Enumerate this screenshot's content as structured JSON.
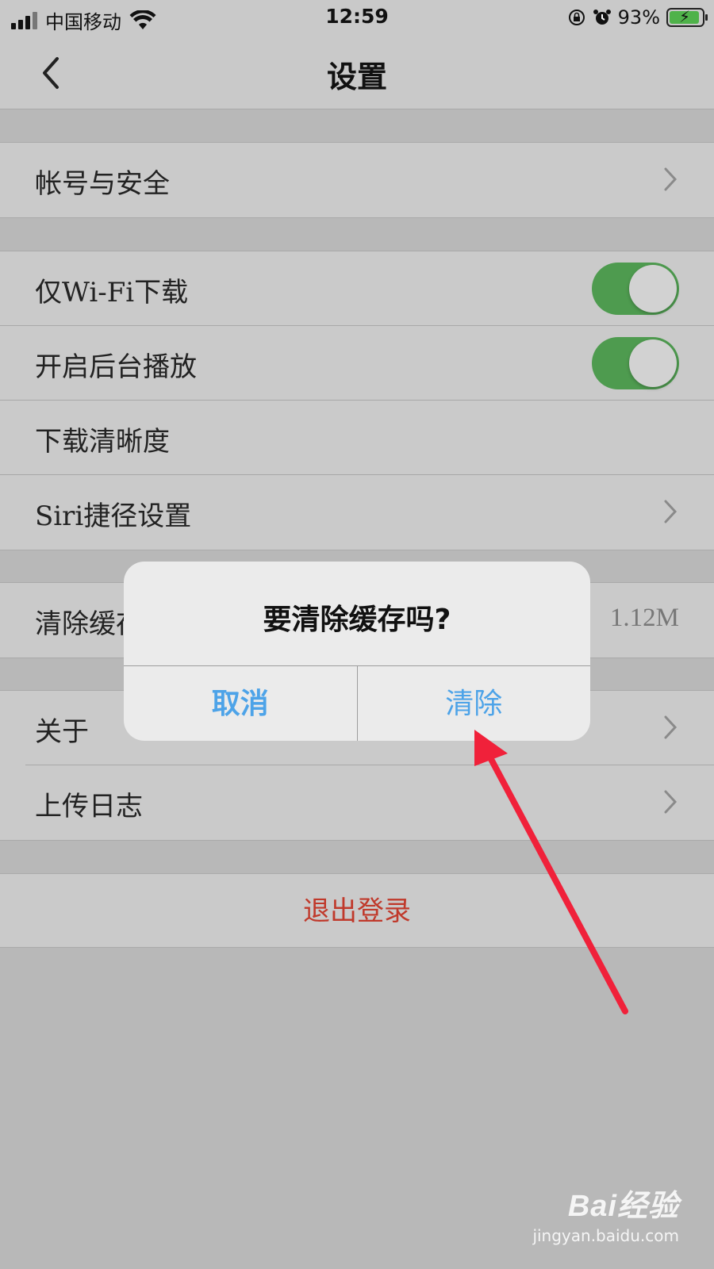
{
  "status_bar": {
    "carrier": "中国移动",
    "time": "12:59",
    "battery": "93%",
    "battery_level": 0.93
  },
  "nav": {
    "title": "设置"
  },
  "settings": {
    "account_security": "帐号与安全",
    "wifi_only_download": "仅Wi-Fi下载",
    "wifi_only_download_on": true,
    "background_play": "开启后台播放",
    "background_play_on": true,
    "download_quality": "下载清晰度",
    "siri_shortcuts": "Siri捷径设置",
    "clear_cache": "清除缓存",
    "cache_size": "1.12M",
    "about": "关于",
    "upload_log": "上传日志",
    "logout": "退出登录"
  },
  "dialog": {
    "title": "要清除缓存吗?",
    "cancel": "取消",
    "confirm": "清除"
  },
  "watermark": {
    "logo": "Bai经验",
    "site": "jingyan.baidu.com"
  },
  "colors": {
    "toggle_on": "#4e9b4f",
    "dialog_button": "#4da3e8",
    "logout": "#c0392b",
    "annotation_arrow": "#f0213a"
  }
}
